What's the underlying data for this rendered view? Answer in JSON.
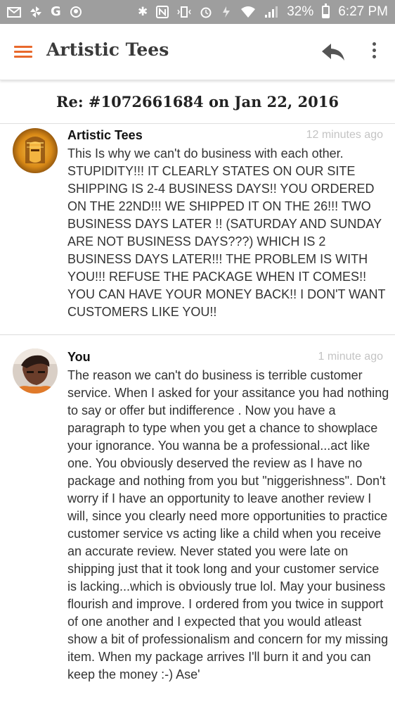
{
  "status_bar": {
    "left_icons": [
      "mail-icon",
      "pinwheel-icon",
      "g-icon",
      "location-icon"
    ],
    "right_icons": [
      "bluetooth-icon",
      "nfc-icon",
      "vibrate-icon",
      "alarm-icon",
      "data-icon",
      "wifi-icon",
      "signal-icon"
    ],
    "battery": "32%",
    "battery_level": 0.32,
    "time": "6:27 PM"
  },
  "app_bar": {
    "title": "Artistic Tees",
    "menu_icon": "hamburger-menu-icon",
    "reply_icon": "reply-icon",
    "more_icon": "more-vert-icon",
    "accent_color": "#e8692c"
  },
  "subject": "Re: #1072661684 on Jan 22, 2016",
  "messages": [
    {
      "sender": "Artistic Tees",
      "time": "12 minutes ago",
      "avatar": "pharaoh-avatar",
      "body": "This Is why we can't do business with each other. STUPIDITY!!!  IT CLEARLY STATES ON OUR SITE SHIPPING IS 2-4 BUSINESS DAYS!! YOU ORDERED ON THE 22ND!!!  WE SHIPPED IT ON THE 26!!! TWO BUSINESS DAYS LATER !! (SATURDAY AND SUNDAY ARE NOT BUSINESS DAYS???)  WHICH IS 2 BUSINESS DAYS LATER!!!  THE PROBLEM IS WITH YOU!!! REFUSE THE PACKAGE WHEN IT COMES!! YOU CAN HAVE YOUR MONEY BACK!! I DON'T WANT CUSTOMERS LIKE YOU!!"
    },
    {
      "sender": "You",
      "time": "1 minute ago",
      "avatar": "user-photo-avatar",
      "body": "The reason we can't do business is terrible customer service. When I asked for your assitance you had nothing to say or offer but indifference . Now you have a paragraph to type when you get a chance to showplace your ignorance. You wanna be a professional...act like one. You obviously deserved the review as I have no package and nothing from you but \"niggerishness\". Don't worry if I have an opportunity to leave another review I will, since you clearly need more opportunities to practice customer service vs acting like a child when you receive an accurate review. Never stated you were late on shipping just that it took long and your customer service is lacking...which is obviously true lol. May your business flourish and improve. I ordered from you twice in support of one another and  I expected that you would atleast show a bit of professionalism and concern for my missing item. When my package arrives I'll burn it and you can keep the money :-) Ase'"
    }
  ]
}
